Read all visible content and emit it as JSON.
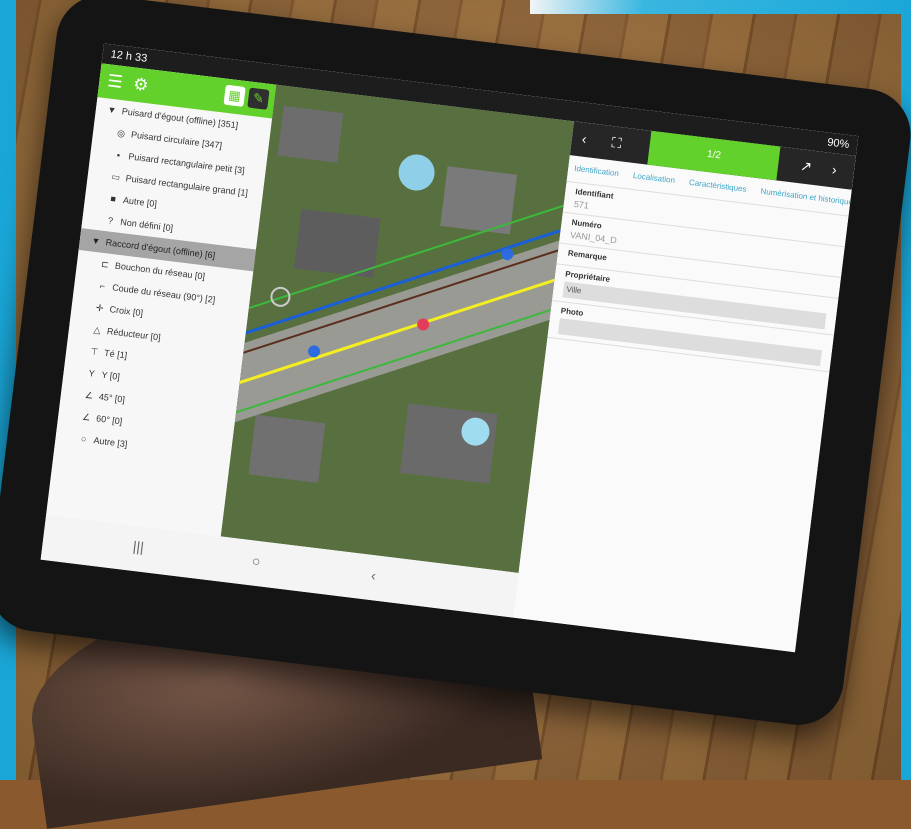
{
  "status": {
    "time": "12 h 33",
    "battery": "90%"
  },
  "toolbar": {
    "menu_icon": "menu-icon",
    "settings_icon": "gear-icon",
    "map_icon": "map-icon",
    "edit_icon": "pencil-icon"
  },
  "layers": [
    {
      "label": "Puisard d'égout (offline) [351]",
      "sym": "▼",
      "type": "group"
    },
    {
      "label": "Puisard circulaire [347]",
      "sym": "◎",
      "type": "item"
    },
    {
      "label": "Puisard rectangulaire petit [3]",
      "sym": "▪",
      "type": "item"
    },
    {
      "label": "Puisard rectangulaire grand [1]",
      "sym": "▭",
      "type": "item"
    },
    {
      "label": "Autre [0]",
      "sym": "■",
      "type": "item"
    },
    {
      "label": "Non défini [0]",
      "sym": "?",
      "type": "item"
    },
    {
      "label": "Raccord d'égout (offline) [6]",
      "sym": "▼",
      "type": "selected"
    },
    {
      "label": "Bouchon du réseau [0]",
      "sym": "⊏",
      "type": "item"
    },
    {
      "label": "Coude du réseau (90°) [2]",
      "sym": "⌐",
      "type": "item"
    },
    {
      "label": "Croix [0]",
      "sym": "✛",
      "type": "item"
    },
    {
      "label": "Réducteur [0]",
      "sym": "△",
      "type": "item"
    },
    {
      "label": "Té [1]",
      "sym": "⊤",
      "type": "item"
    },
    {
      "label": "Y [0]",
      "sym": "Y",
      "type": "item"
    },
    {
      "label": "45° [0]",
      "sym": "∠",
      "type": "item"
    },
    {
      "label": "60° [0]",
      "sym": "∠",
      "type": "item"
    },
    {
      "label": "Autre [3]",
      "sym": "○",
      "type": "item"
    }
  ],
  "feature": {
    "page": "1/2",
    "tabs": [
      "Identification",
      "Localisation",
      "Caractéristiques",
      "Numérisation et historique"
    ],
    "fields": [
      {
        "label": "Identifiant",
        "value": "571"
      },
      {
        "label": "Numéro",
        "value": "VANI_04_D"
      },
      {
        "label": "Remarque",
        "value": ""
      },
      {
        "label": "Propriétaire",
        "value": "Ville"
      },
      {
        "label": "Photo",
        "value": ""
      }
    ]
  }
}
